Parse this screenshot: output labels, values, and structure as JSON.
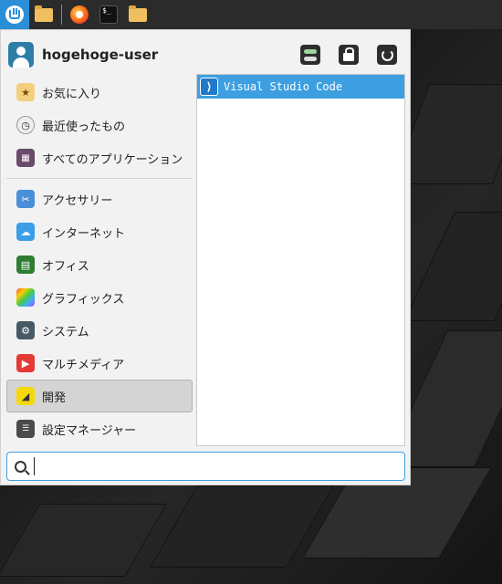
{
  "user": {
    "name": "hogehoge-user"
  },
  "header_actions": [
    {
      "name": "settings-toggle-icon",
      "color": "#2d2d2d"
    },
    {
      "name": "lock-icon",
      "color": "#2d2d2d"
    },
    {
      "name": "power-icon",
      "color": "#2d2d2d"
    }
  ],
  "categories": {
    "favorites": "お気に入り",
    "recent": "最近使ったもの",
    "all_apps": "すべてのアプリケーション",
    "accessories": "アクセサリー",
    "internet": "インターネット",
    "office": "オフィス",
    "graphics": "グラフィックス",
    "system": "システム",
    "multimedia": "マルチメディア",
    "development": "開発",
    "settings": "設定マネージャー"
  },
  "selected_category": "開発",
  "apps": [
    {
      "label": "Visual Studio Code",
      "icon": "vscode-icon"
    }
  ],
  "search": {
    "value": "",
    "placeholder": ""
  },
  "colors": {
    "accent": "#3d9fe0",
    "panel": "#2b2b2b",
    "menu_bg": "#f2f2f2"
  }
}
